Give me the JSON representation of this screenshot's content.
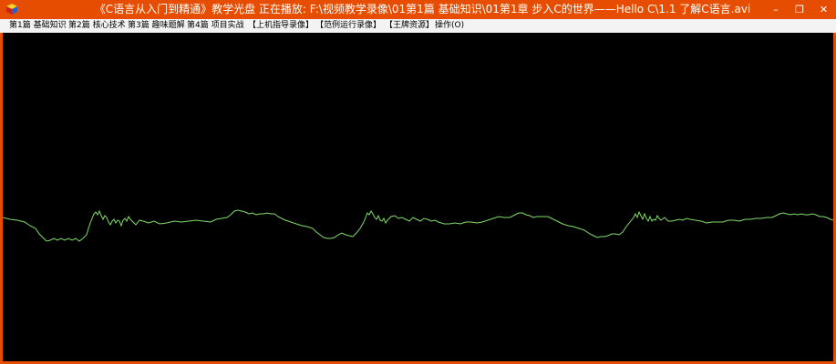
{
  "window": {
    "title": "《C语言从入门到精通》教学光盘 正在播放: F:\\视频教学录像\\01第1篇 基础知识\\01第1章 步入C的世界——Hello C\\1.1 了解C语言.avi",
    "titlebar_color": "#e64d00",
    "app_icon": "cube-app-icon",
    "controls": {
      "minimize": "–",
      "restore": "❐",
      "close": "✕"
    }
  },
  "menu": {
    "items": [
      {
        "label": "第1篇 基础知识"
      },
      {
        "label": "第2篇 核心技术"
      },
      {
        "label": "第3篇 趣味题解"
      },
      {
        "label": "第4篇 项目实战"
      },
      {
        "label": "【上机指导录像】"
      },
      {
        "label": "【范例运行录像】"
      },
      {
        "label": "【王牌资源】"
      },
      {
        "label": "操作(O)"
      }
    ]
  },
  "player": {
    "background": "#000000",
    "waveform_color": "#7fdc6a"
  }
}
